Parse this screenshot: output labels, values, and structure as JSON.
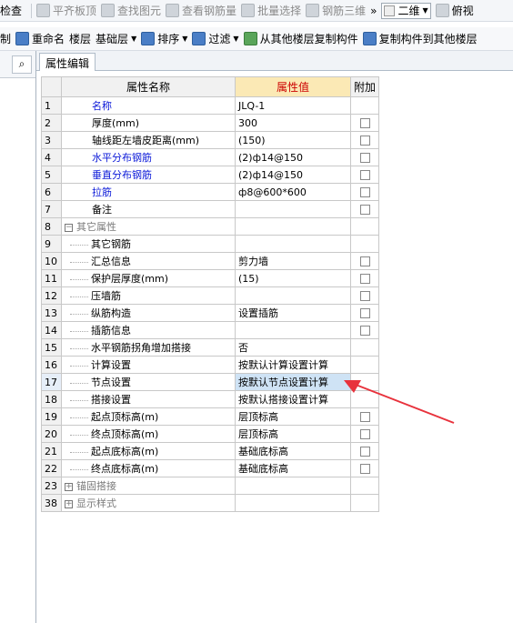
{
  "toolbar1": {
    "items": [
      "检查",
      "平齐板顶",
      "查找图元",
      "查看钢筋量",
      "批量选择",
      "钢筋三维"
    ],
    "view_select": "二维",
    "view_label": "俯视"
  },
  "toolbar2": {
    "control": "制",
    "rename": "重命名",
    "floor_label": "楼层",
    "floor_value": "基础层",
    "sort": "排序",
    "filter": "过滤",
    "copy_from": "从其他楼层复制构件",
    "copy_to": "复制构件到其他楼层"
  },
  "left": {
    "search_icon": "⌕"
  },
  "tab": {
    "label": "属性编辑"
  },
  "table": {
    "headers": {
      "name": "属性名称",
      "value": "属性值",
      "extra": "附加"
    },
    "rows": [
      {
        "n": "1",
        "name": "名称",
        "value": "JLQ-1",
        "cb": false,
        "blue": true
      },
      {
        "n": "2",
        "name": "厚度(mm)",
        "value": "300",
        "cb": true
      },
      {
        "n": "3",
        "name": "轴线距左墙皮距离(mm)",
        "value": "(150)",
        "cb": true
      },
      {
        "n": "4",
        "name": "水平分布钢筋",
        "value": "(2)ф14@150",
        "cb": true,
        "blue": true
      },
      {
        "n": "5",
        "name": "垂直分布钢筋",
        "value": "(2)ф14@150",
        "cb": true,
        "blue": true
      },
      {
        "n": "6",
        "name": "拉筋",
        "value": "ф8@600*600",
        "cb": true,
        "blue": true
      },
      {
        "n": "7",
        "name": "备注",
        "value": "",
        "cb": true
      },
      {
        "n": "8",
        "name": "其它属性",
        "value": "",
        "group": "−"
      },
      {
        "n": "9",
        "name": "其它钢筋",
        "value": "",
        "child": true
      },
      {
        "n": "10",
        "name": "汇总信息",
        "value": "剪力墙",
        "cb": true,
        "child": true
      },
      {
        "n": "11",
        "name": "保护层厚度(mm)",
        "value": "(15)",
        "cb": true,
        "child": true
      },
      {
        "n": "12",
        "name": "压墙筋",
        "value": "",
        "cb": true,
        "child": true
      },
      {
        "n": "13",
        "name": "纵筋构造",
        "value": "设置插筋",
        "cb": true,
        "child": true
      },
      {
        "n": "14",
        "name": "插筋信息",
        "value": "",
        "cb": true,
        "child": true
      },
      {
        "n": "15",
        "name": "水平钢筋拐角增加搭接",
        "value": "否",
        "child": true
      },
      {
        "n": "16",
        "name": "计算设置",
        "value": "按默认计算设置计算",
        "child": true
      },
      {
        "n": "17",
        "name": "节点设置",
        "value": "按默认节点设置计算",
        "child": true,
        "sel": true
      },
      {
        "n": "18",
        "name": "搭接设置",
        "value": "按默认搭接设置计算",
        "child": true
      },
      {
        "n": "19",
        "name": "起点顶标高(m)",
        "value": "层顶标高",
        "cb": true,
        "child": true
      },
      {
        "n": "20",
        "name": "终点顶标高(m)",
        "value": "层顶标高",
        "cb": true,
        "child": true
      },
      {
        "n": "21",
        "name": "起点底标高(m)",
        "value": "基础底标高",
        "cb": true,
        "child": true
      },
      {
        "n": "22",
        "name": "终点底标高(m)",
        "value": "基础底标高",
        "cb": true,
        "child": true
      },
      {
        "n": "23",
        "name": "锚固搭接",
        "value": "",
        "group": "+"
      },
      {
        "n": "38",
        "name": "显示样式",
        "value": "",
        "group": "+"
      }
    ]
  },
  "colors": {
    "arrow": "#e8323c",
    "header_value_bg": "#fbe9b5",
    "link_blue": "#0a18d8"
  }
}
